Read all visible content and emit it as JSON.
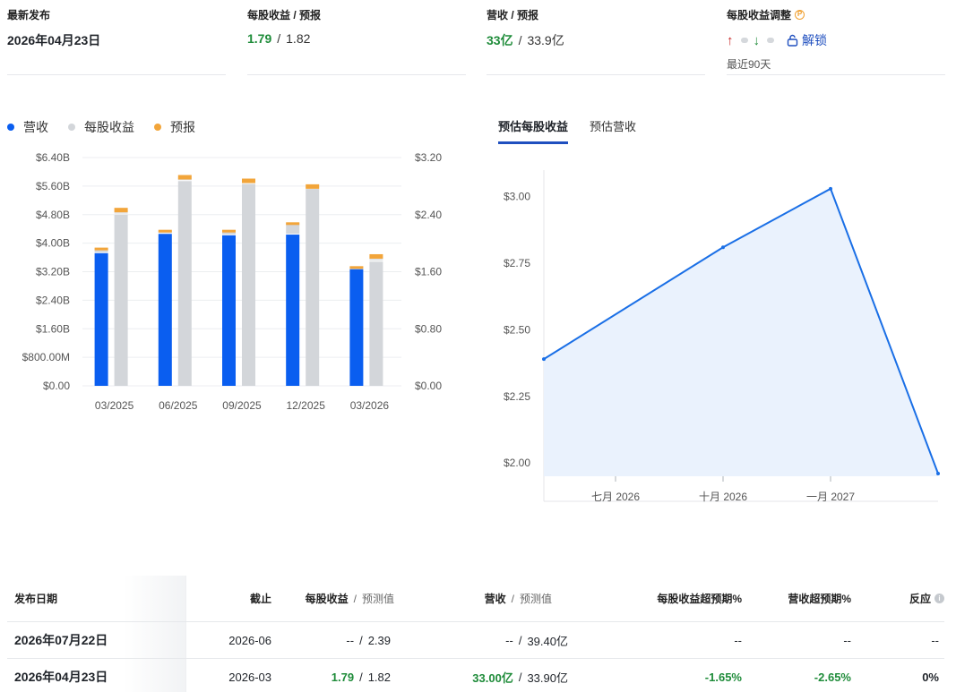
{
  "kpis": {
    "latest": {
      "label": "最新发布",
      "value": "2026年04月23日"
    },
    "eps": {
      "label": "每股收益 / 预报",
      "actual": "1.79",
      "sep": "/",
      "estimate": "1.82"
    },
    "revenue": {
      "label": "营收 / 预报",
      "actual": "33亿",
      "sep": "/",
      "estimate": "33.9亿"
    },
    "revision": {
      "label": "每股收益调整",
      "badge": "P",
      "unlock": "解锁",
      "period": "最近90天"
    }
  },
  "legend": [
    {
      "label": "营收",
      "color": "#0a5ef0"
    },
    {
      "label": "每股收益",
      "color": "#d3d6da"
    },
    {
      "label": "预报",
      "color": "#f2a53a"
    }
  ],
  "tabs": [
    {
      "label": "预估每股收益",
      "active": true
    },
    {
      "label": "预估营收",
      "active": false
    }
  ],
  "chart_data": [
    {
      "type": "bar",
      "categories": [
        "03/2025",
        "06/2025",
        "09/2025",
        "12/2025",
        "03/2026"
      ],
      "y_left_ticks": [
        "$0.00",
        "$800.00M",
        "$1.60B",
        "$2.40B",
        "$3.20B",
        "$4.00B",
        "$4.80B",
        "$5.60B",
        "$6.40B"
      ],
      "y_right_ticks": [
        "$0.00",
        "$0.80",
        "$1.60",
        "$2.40",
        "$3.20"
      ],
      "ylim_left": [
        0,
        6.4
      ],
      "ylim_right": [
        0,
        3.2
      ],
      "series": [
        {
          "name": "营收",
          "axis": "left",
          "values": [
            3.72,
            4.26,
            4.22,
            4.24,
            3.27
          ],
          "estimate": [
            3.85,
            4.35,
            4.35,
            4.56,
            3.33
          ]
        },
        {
          "name": "每股收益",
          "axis": "right",
          "values": [
            2.4,
            2.87,
            2.83,
            2.76,
            1.74
          ],
          "estimate": [
            2.47,
            2.93,
            2.88,
            2.8,
            1.82
          ]
        }
      ]
    },
    {
      "type": "area",
      "x": [
        "2026-05",
        "2026-10",
        "2027-01",
        "2027-04"
      ],
      "x_ticks": [
        "七月 2026",
        "十月 2026",
        "一月 2027"
      ],
      "y_ticks": [
        "$2.00",
        "$2.25",
        "$2.50",
        "$2.75",
        "$3.00"
      ],
      "ylim": [
        1.95,
        3.1
      ],
      "values": [
        2.39,
        2.81,
        3.03,
        1.96
      ]
    }
  ],
  "table": {
    "headers": {
      "date": "发布日期",
      "period": "截止",
      "eps": "每股收益",
      "eps_est": "预测值",
      "rev": "营收",
      "rev_est": "预测值",
      "eps_surprise": "每股收益超预期%",
      "rev_surprise": "营收超预期%",
      "reaction": "反应",
      "sep": "/"
    },
    "rows": [
      {
        "date": "2026年07月22日",
        "period": "2026-06",
        "eps": "--",
        "eps_est": "2.39",
        "rev": "--",
        "rev_est": "39.40亿",
        "eps_surprise": "--",
        "rev_surprise": "--",
        "reaction": "--"
      },
      {
        "date": "2026年04月23日",
        "period": "2026-03",
        "eps": "1.79",
        "eps_est": "1.82",
        "rev": "33.00亿",
        "rev_est": "33.90亿",
        "eps_surprise": "-1.65%",
        "rev_surprise": "-2.65%",
        "reaction": "0%"
      }
    ]
  }
}
